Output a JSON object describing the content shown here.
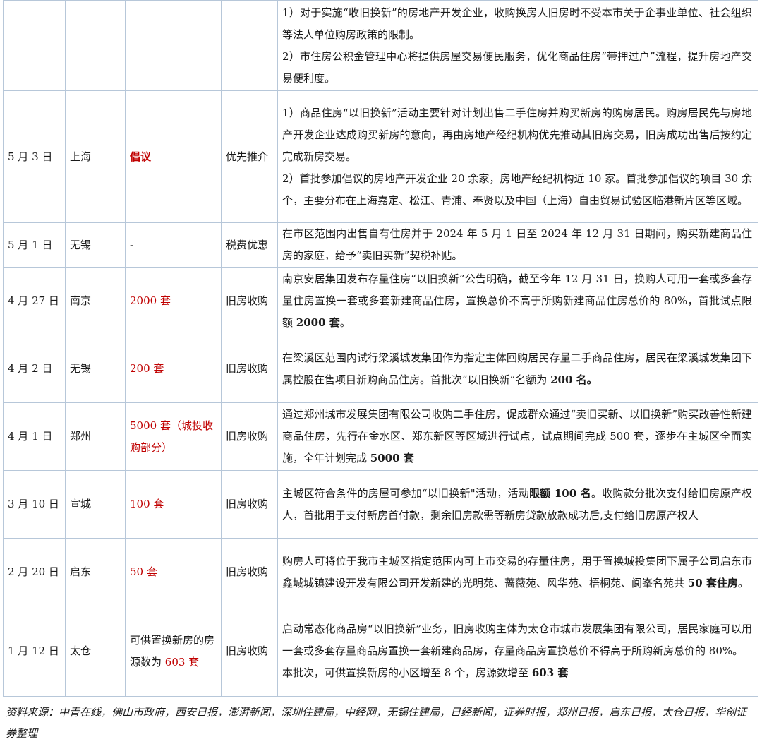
{
  "rows": [
    {
      "date": "",
      "city": "",
      "measure": "",
      "measure_red": true,
      "type": "",
      "details": [
        {
          "segments": [
            {
              "text": "1）对于实施“收旧换新”的房地产开发企业，收购换房人旧房时不受本市关于企事业单位、社会组织等法人单位购房政策的限制。",
              "bold": false
            }
          ]
        },
        {
          "segments": [
            {
              "text": "2）市住房公积金管理中心将提供房屋交易便民服务，优化商品住房“带押过户”流程，提升房地产交易便利度。",
              "bold": false
            }
          ]
        }
      ]
    },
    {
      "date": "5 月 3 日",
      "city": "上海",
      "measure": "倡议",
      "measure_red": true,
      "measure_bold": true,
      "type": "优先推介",
      "details": [
        {
          "segments": [
            {
              "text": "1）商品住房“以旧换新”活动主要针对计划出售二手住房并购买新房的购房居民。购房居民先与房地产开发企业达成购买新房的意向，再由房地产经纪机构优先推动其旧房交易，旧房成功出售后按约定完成新房交易。",
              "bold": false
            }
          ]
        },
        {
          "segments": [
            {
              "text": "2）首批参加倡议的房地产开发企业 20 余家，房地产经纪机构近 10 家。首批参加倡议的项目 30 余个，主要分布在上海嘉定、松江、青浦、奉贤以及中国（上海）自由贸易试验区临港新片区等区域。",
              "bold": false
            }
          ]
        }
      ]
    },
    {
      "date": "5 月 1 日",
      "city": "无锡",
      "measure": "-",
      "measure_red": false,
      "type": "税费优惠",
      "details": [
        {
          "segments": [
            {
              "text": "在市区范围内出售自有住房并于 2024 年 5 月 1 日至 2024 年 12 月 31 日期间，购买新建商品住房的家庭，给予“卖旧买新”契税补贴。",
              "bold": false
            }
          ]
        }
      ]
    },
    {
      "date": "4 月 27 日",
      "city": "南京",
      "measure": "2000 套",
      "measure_red": true,
      "type": "旧房收购",
      "details": [
        {
          "segments": [
            {
              "text": "南京安居集团发布存量住房“以旧换新”公告明确，截至今年 12 月 31 日，换购人可用一套或多套存量住房置换一套或多套新建商品住房，置换总价不高于所购新建商品住房总价的 80%，首批试点限额 ",
              "bold": false
            },
            {
              "text": "2000 套",
              "bold": true
            },
            {
              "text": "。",
              "bold": false
            }
          ]
        }
      ]
    },
    {
      "date": "4 月 2 日",
      "city": "无锡",
      "measure": "200 套",
      "measure_red": true,
      "type": "旧房收购",
      "details": [
        {
          "segments": [
            {
              "text": "在梁溪区范围内试行梁溪城发集团作为指定主体回购居民存量二手商品住房，居民在梁溪城发集团下属控股在售项目新购商品住房。首批次“以旧换新”名额为 ",
              "bold": false
            },
            {
              "text": "200 名。",
              "bold": true
            }
          ]
        }
      ]
    },
    {
      "date": "4 月 1 日",
      "city": "郑州",
      "measure": "5000 套（城投收购部分）",
      "measure_red": true,
      "type": "旧房收购",
      "details": [
        {
          "segments": [
            {
              "text": "通过郑州城市发展集团有限公司收购二手住房，促成群众通过“卖旧买新、以旧换新”购买改善性新建商品住房，先行在金水区、郑东新区等区域进行试点，试点期间完成 500 套，逐步在主城区全面实施，全年计划完成 ",
              "bold": false
            },
            {
              "text": "5000 套",
              "bold": true
            }
          ]
        }
      ]
    },
    {
      "date": "3 月 10 日",
      "city": "宣城",
      "measure": "100 套",
      "measure_red": true,
      "type": "旧房收购",
      "details": [
        {
          "segments": [
            {
              "text": "主城区符合条件的房屋可参加“以旧换新\"活动，活动",
              "bold": false
            },
            {
              "text": "限额 100 名",
              "bold": true
            },
            {
              "text": "。收购款分批次支付给旧房原产权人，首批用于支付新房首付款，剩余旧房款需等新房贷款放款成功后,支付给旧房原产权人",
              "bold": false
            }
          ]
        }
      ]
    },
    {
      "date": "2 月 20 日",
      "city": "启东",
      "measure": "50 套",
      "measure_red": true,
      "type": "旧房收购",
      "details": [
        {
          "segments": [
            {
              "text": "购房人可将位于我市主城区指定范围内可上市交易的存量住房，用于置换城投集团下属子公司启东市鑫城城镇建设开发有限公司开发新建的光明苑、蔷薇苑、风华苑、梧桐苑、阆峯名苑共 ",
              "bold": false
            },
            {
              "text": "50 套住房",
              "bold": true
            },
            {
              "text": "。",
              "bold": false
            }
          ]
        }
      ]
    },
    {
      "date": "1 月 12 日",
      "city": "太仓",
      "measure": "可供置换新房的房源数为 603 套",
      "measure_red": false,
      "measure_tail": "603 套",
      "type": "旧房收购",
      "details": [
        {
          "segments": [
            {
              "text": "启动常态化商品房“以旧换新”业务，旧房收购主体为太仓市城市发展集团有限公司，居民家庭可以用一套或多套存量商品房置换一套新建商品房，存量商品房置换总价不得高于所购新房总价的 80%。",
              "bold": false
            }
          ]
        },
        {
          "segments": [
            {
              "text": "本批次，可供置换新房的小区增至 8 个，房源数增至 ",
              "bold": false
            },
            {
              "text": "603 套",
              "bold": true
            }
          ]
        }
      ]
    }
  ],
  "source_note": "资料来源：中青在线，佛山市政府，西安日报，澎湃新闻，深圳住建局，中经网，无锡住建局，日经新闻，证券时报，郑州日报，启东日报，太仓日报，华创证券整理"
}
